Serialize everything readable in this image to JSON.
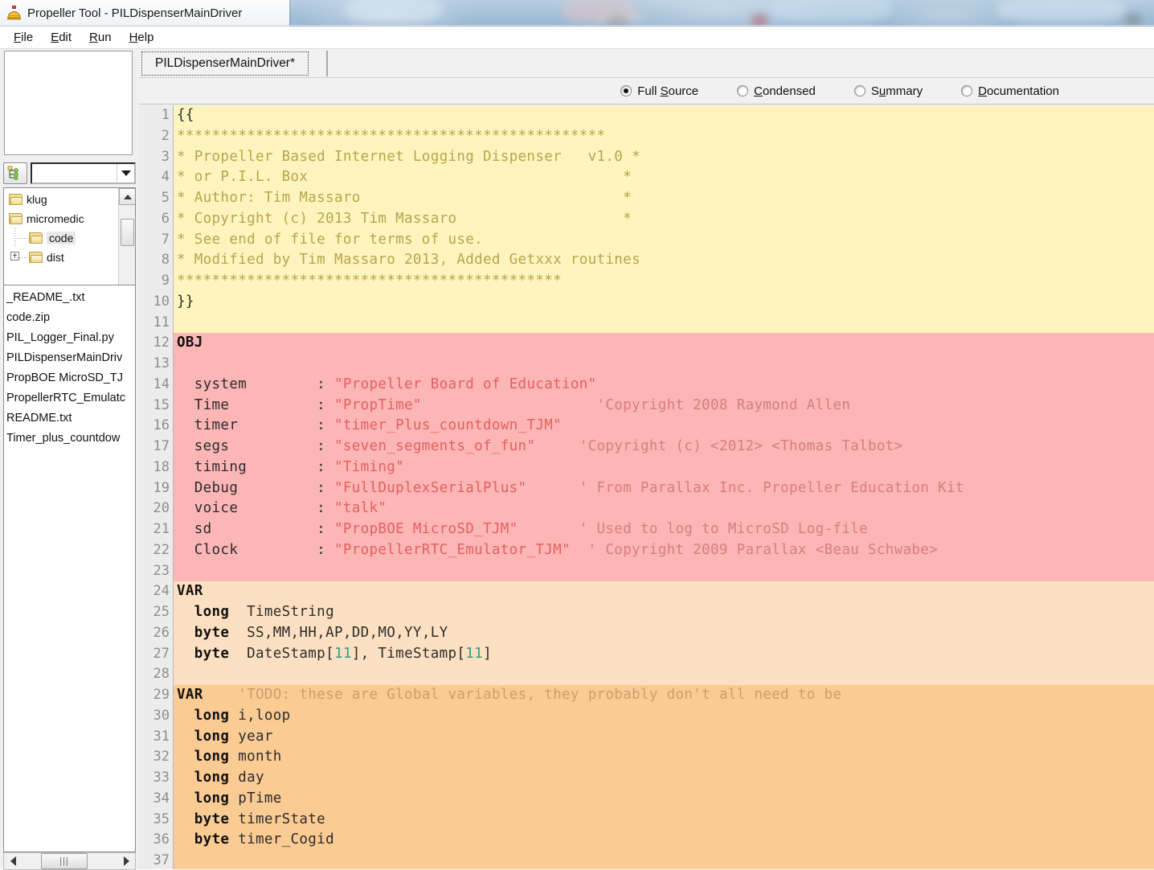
{
  "window": {
    "title": "Propeller Tool - PILDispenserMainDriver",
    "app_icon": "propeller-tool-icon"
  },
  "menubar": {
    "items": [
      {
        "label": "File",
        "accel": "F"
      },
      {
        "label": "Edit",
        "accel": "E"
      },
      {
        "label": "Run",
        "accel": "R"
      },
      {
        "label": "Help",
        "accel": "H"
      }
    ]
  },
  "sidebar": {
    "combo_value": "",
    "tree_button_icon": "folder-tree-icon",
    "combo_arrow_icon": "chevron-down-icon",
    "tree": [
      {
        "label": "klug",
        "indent": 0,
        "selected": false
      },
      {
        "label": "micromedic",
        "indent": 0,
        "selected": false
      },
      {
        "label": "code",
        "indent": 1,
        "selected": true
      },
      {
        "label": "dist",
        "indent": 1,
        "selected": false
      }
    ],
    "files": [
      "_README_.txt",
      "code.zip",
      "PIL_Logger_Final.py",
      "PILDispenserMainDriv",
      "PropBOE MicroSD_TJ",
      "PropellerRTC_Emulatc",
      "README.txt",
      "Timer_plus_countdow"
    ],
    "scroll": {
      "up_icon": "triangle-up-icon",
      "down_icon": "triangle-down-icon",
      "left_icon": "triangle-left-icon",
      "right_icon": "triangle-right-icon",
      "grip": "|||"
    }
  },
  "tabs": [
    {
      "label": "PILDispenserMainDriver*",
      "active": true
    }
  ],
  "view_modes": [
    {
      "label_pre": "Full ",
      "accel": "S",
      "label_post": "ource",
      "selected": true
    },
    {
      "label_pre": "",
      "accel": "C",
      "label_post": "ondensed",
      "selected": false
    },
    {
      "label_pre": "S",
      "accel": "u",
      "label_post": "mmary",
      "selected": false
    },
    {
      "label_pre": "",
      "accel": "D",
      "label_post": "ocumentation",
      "selected": false
    }
  ],
  "colors": {
    "comment_block_bg": "#fdf5bd",
    "obj_block_bg": "#fcb6b6",
    "var_block_bg": "#fde0c1",
    "var_block2_bg": "#fbcb94",
    "gutter_bg": "#ececec",
    "linenum_fg": "#8e8e8e",
    "obj_string_fg": "#e4605e",
    "comment_fg": "#b8a44e",
    "number_fg": "#2e9e86"
  },
  "editor": {
    "first_line": 1,
    "last_visible_line": 37,
    "lines": [
      {
        "n": 1,
        "bg": "bg-com",
        "spans": [
          {
            "c": "t-plain",
            "t": "{{"
          }
        ]
      },
      {
        "n": 2,
        "bg": "bg-com",
        "spans": [
          {
            "c": "t-com",
            "t": "*************************************************"
          }
        ]
      },
      {
        "n": 3,
        "bg": "bg-com",
        "spans": [
          {
            "c": "t-com",
            "t": "* Propeller Based Internet Logging Dispenser   v1.0 *"
          }
        ]
      },
      {
        "n": 4,
        "bg": "bg-com",
        "spans": [
          {
            "c": "t-com",
            "t": "* or P.I.L. Box                                    *"
          }
        ]
      },
      {
        "n": 5,
        "bg": "bg-com",
        "spans": [
          {
            "c": "t-com",
            "t": "* Author: Tim Massaro                              *"
          }
        ]
      },
      {
        "n": 6,
        "bg": "bg-com",
        "spans": [
          {
            "c": "t-com",
            "t": "* Copyright (c) 2013 Tim Massaro                   *"
          }
        ]
      },
      {
        "n": 7,
        "bg": "bg-com",
        "spans": [
          {
            "c": "t-com",
            "t": "* See end of file for terms of use."
          }
        ]
      },
      {
        "n": 8,
        "bg": "bg-com",
        "spans": [
          {
            "c": "t-com",
            "t": "* Modified by Tim Massaro 2013, Added Getxxx routines"
          }
        ]
      },
      {
        "n": 9,
        "bg": "bg-com",
        "spans": [
          {
            "c": "t-com",
            "t": "********************************************"
          }
        ]
      },
      {
        "n": 10,
        "bg": "bg-com",
        "spans": [
          {
            "c": "t-plain",
            "t": "}}"
          }
        ]
      },
      {
        "n": 11,
        "bg": "bg-com",
        "spans": [
          {
            "c": "t-plain",
            "t": ""
          }
        ]
      },
      {
        "n": 12,
        "bg": "bg-obj",
        "spans": [
          {
            "c": "t-block",
            "t": "OBJ"
          }
        ]
      },
      {
        "n": 13,
        "bg": "bg-obj",
        "spans": [
          {
            "c": "t-plain",
            "t": ""
          }
        ]
      },
      {
        "n": 14,
        "bg": "bg-obj",
        "spans": [
          {
            "c": "t-objname",
            "t": "  system        : "
          },
          {
            "c": "t-objstr",
            "t": "\"Propeller Board of Education\""
          }
        ]
      },
      {
        "n": 15,
        "bg": "bg-obj",
        "spans": [
          {
            "c": "t-objname",
            "t": "  Time          : "
          },
          {
            "c": "t-objstr",
            "t": "\"PropTime\""
          },
          {
            "c": "t-objcom",
            "t": "                    'Copyright 2008 Raymond Allen"
          }
        ]
      },
      {
        "n": 16,
        "bg": "bg-obj",
        "spans": [
          {
            "c": "t-objname",
            "t": "  timer         : "
          },
          {
            "c": "t-objstr",
            "t": "\"timer_Plus_countdown_TJM\""
          }
        ]
      },
      {
        "n": 17,
        "bg": "bg-obj",
        "spans": [
          {
            "c": "t-objname",
            "t": "  segs          : "
          },
          {
            "c": "t-objstr",
            "t": "\"seven_segments_of_fun\""
          },
          {
            "c": "t-objcom",
            "t": "     'Copyright (c) <2012> <Thomas Talbot>"
          }
        ]
      },
      {
        "n": 18,
        "bg": "bg-obj",
        "spans": [
          {
            "c": "t-objname",
            "t": "  timing        : "
          },
          {
            "c": "t-objstr",
            "t": "\"Timing\""
          }
        ]
      },
      {
        "n": 19,
        "bg": "bg-obj",
        "spans": [
          {
            "c": "t-objname",
            "t": "  Debug         : "
          },
          {
            "c": "t-objstr",
            "t": "\"FullDuplexSerialPlus\""
          },
          {
            "c": "t-objcom",
            "t": "      ' From Parallax Inc. Propeller Education Kit"
          }
        ]
      },
      {
        "n": 20,
        "bg": "bg-obj",
        "spans": [
          {
            "c": "t-objname",
            "t": "  voice         : "
          },
          {
            "c": "t-objstr",
            "t": "\"talk\""
          }
        ]
      },
      {
        "n": 21,
        "bg": "bg-obj",
        "spans": [
          {
            "c": "t-objname",
            "t": "  sd            : "
          },
          {
            "c": "t-objstr",
            "t": "\"PropBOE MicroSD_TJM\""
          },
          {
            "c": "t-objcom",
            "t": "       ' Used to log to MicroSD Log-file"
          }
        ]
      },
      {
        "n": 22,
        "bg": "bg-obj",
        "spans": [
          {
            "c": "t-objname",
            "t": "  Clock         : "
          },
          {
            "c": "t-objstr",
            "t": "\"PropellerRTC_Emulator_TJM\""
          },
          {
            "c": "t-objcom",
            "t": "  ' Copyright 2009 Parallax <Beau Schwabe>"
          }
        ]
      },
      {
        "n": 23,
        "bg": "bg-obj",
        "spans": [
          {
            "c": "t-plain",
            "t": ""
          }
        ]
      },
      {
        "n": 24,
        "bg": "bg-var1",
        "spans": [
          {
            "c": "t-block",
            "t": "VAR"
          }
        ]
      },
      {
        "n": 25,
        "bg": "bg-var1",
        "spans": [
          {
            "c": "t-kw",
            "t": "  long"
          },
          {
            "c": "t-plain",
            "t": "  TimeString"
          }
        ]
      },
      {
        "n": 26,
        "bg": "bg-var1",
        "spans": [
          {
            "c": "t-kw",
            "t": "  byte"
          },
          {
            "c": "t-plain",
            "t": "  SS,MM,HH,AP,DD,MO,YY,LY"
          }
        ]
      },
      {
        "n": 27,
        "bg": "bg-var1",
        "spans": [
          {
            "c": "t-kw",
            "t": "  byte"
          },
          {
            "c": "t-plain",
            "t": "  DateStamp["
          },
          {
            "c": "t-num",
            "t": "11"
          },
          {
            "c": "t-plain",
            "t": "], TimeStamp["
          },
          {
            "c": "t-num",
            "t": "11"
          },
          {
            "c": "t-plain",
            "t": "]"
          }
        ]
      },
      {
        "n": 28,
        "bg": "bg-var1",
        "spans": [
          {
            "c": "t-plain",
            "t": ""
          }
        ]
      },
      {
        "n": 29,
        "bg": "bg-var2",
        "spans": [
          {
            "c": "t-block",
            "t": "VAR"
          },
          {
            "c": "t-varcom",
            "t": "    'TODO: these are Global variables, they probably don't all need to be"
          }
        ]
      },
      {
        "n": 30,
        "bg": "bg-var2",
        "spans": [
          {
            "c": "t-kw",
            "t": "  long"
          },
          {
            "c": "t-plain",
            "t": " i,loop"
          }
        ]
      },
      {
        "n": 31,
        "bg": "bg-var2",
        "spans": [
          {
            "c": "t-kw",
            "t": "  long"
          },
          {
            "c": "t-plain",
            "t": " year"
          }
        ]
      },
      {
        "n": 32,
        "bg": "bg-var2",
        "spans": [
          {
            "c": "t-kw",
            "t": "  long"
          },
          {
            "c": "t-plain",
            "t": " month"
          }
        ]
      },
      {
        "n": 33,
        "bg": "bg-var2",
        "spans": [
          {
            "c": "t-kw",
            "t": "  long"
          },
          {
            "c": "t-plain",
            "t": " day"
          }
        ]
      },
      {
        "n": 34,
        "bg": "bg-var2",
        "spans": [
          {
            "c": "t-kw",
            "t": "  long"
          },
          {
            "c": "t-plain",
            "t": " pTime"
          }
        ]
      },
      {
        "n": 35,
        "bg": "bg-var2",
        "spans": [
          {
            "c": "t-kw",
            "t": "  byte"
          },
          {
            "c": "t-plain",
            "t": " timerState"
          }
        ]
      },
      {
        "n": 36,
        "bg": "bg-var2",
        "spans": [
          {
            "c": "t-kw",
            "t": "  byte"
          },
          {
            "c": "t-plain",
            "t": " timer_Cogid"
          }
        ]
      },
      {
        "n": 37,
        "bg": "bg-var2",
        "spans": [
          {
            "c": "t-plain",
            "t": ""
          }
        ]
      }
    ]
  }
}
